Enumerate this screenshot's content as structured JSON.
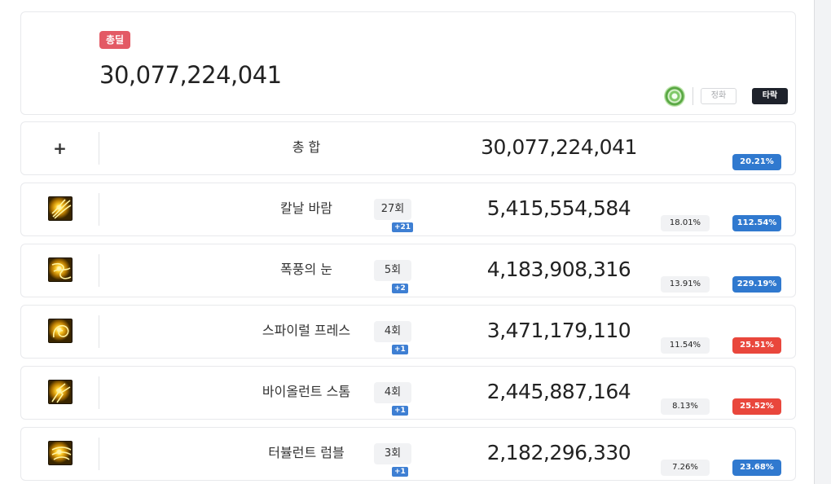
{
  "summary": {
    "badge": "총딜",
    "total_damage": "30,077,224,041",
    "skill_orb_icon": "green-orb-skill-icon",
    "toggle_off_label": "정화",
    "toggle_on_label": "타락"
  },
  "total_row": {
    "icon": "plus-icon",
    "name": "총 합",
    "damage": "30,077,224,041",
    "percent": "20.21%",
    "percent_color": "#3079cf"
  },
  "skills": [
    {
      "name": "칼날 바람",
      "icon": "blade-wind-icon",
      "count": "27회",
      "count_delta": "+21",
      "damage": "5,415,554,584",
      "share": "18.01%",
      "percent": "112.54%",
      "percent_color": "#3079cf"
    },
    {
      "name": "폭풍의 눈",
      "icon": "storm-eye-icon",
      "count": "5회",
      "count_delta": "+2",
      "damage": "4,183,908,316",
      "share": "13.91%",
      "percent": "229.19%",
      "percent_color": "#3079cf"
    },
    {
      "name": "스파이럴 프레스",
      "icon": "spiral-press-icon",
      "count": "4회",
      "count_delta": "+1",
      "damage": "3,471,179,110",
      "share": "11.54%",
      "percent": "25.51%",
      "percent_color": "#e9473c"
    },
    {
      "name": "바이올런트 스톰",
      "icon": "violent-storm-icon",
      "count": "4회",
      "count_delta": "+1",
      "damage": "2,445,887,164",
      "share": "8.13%",
      "percent": "25.52%",
      "percent_color": "#e9473c"
    },
    {
      "name": "터뷸런트 럼블",
      "icon": "turbulent-rumble-icon",
      "count": "3회",
      "count_delta": "+1",
      "damage": "2,182,296,330",
      "share": "7.26%",
      "percent": "23.68%",
      "percent_color": "#3079cf"
    }
  ]
}
